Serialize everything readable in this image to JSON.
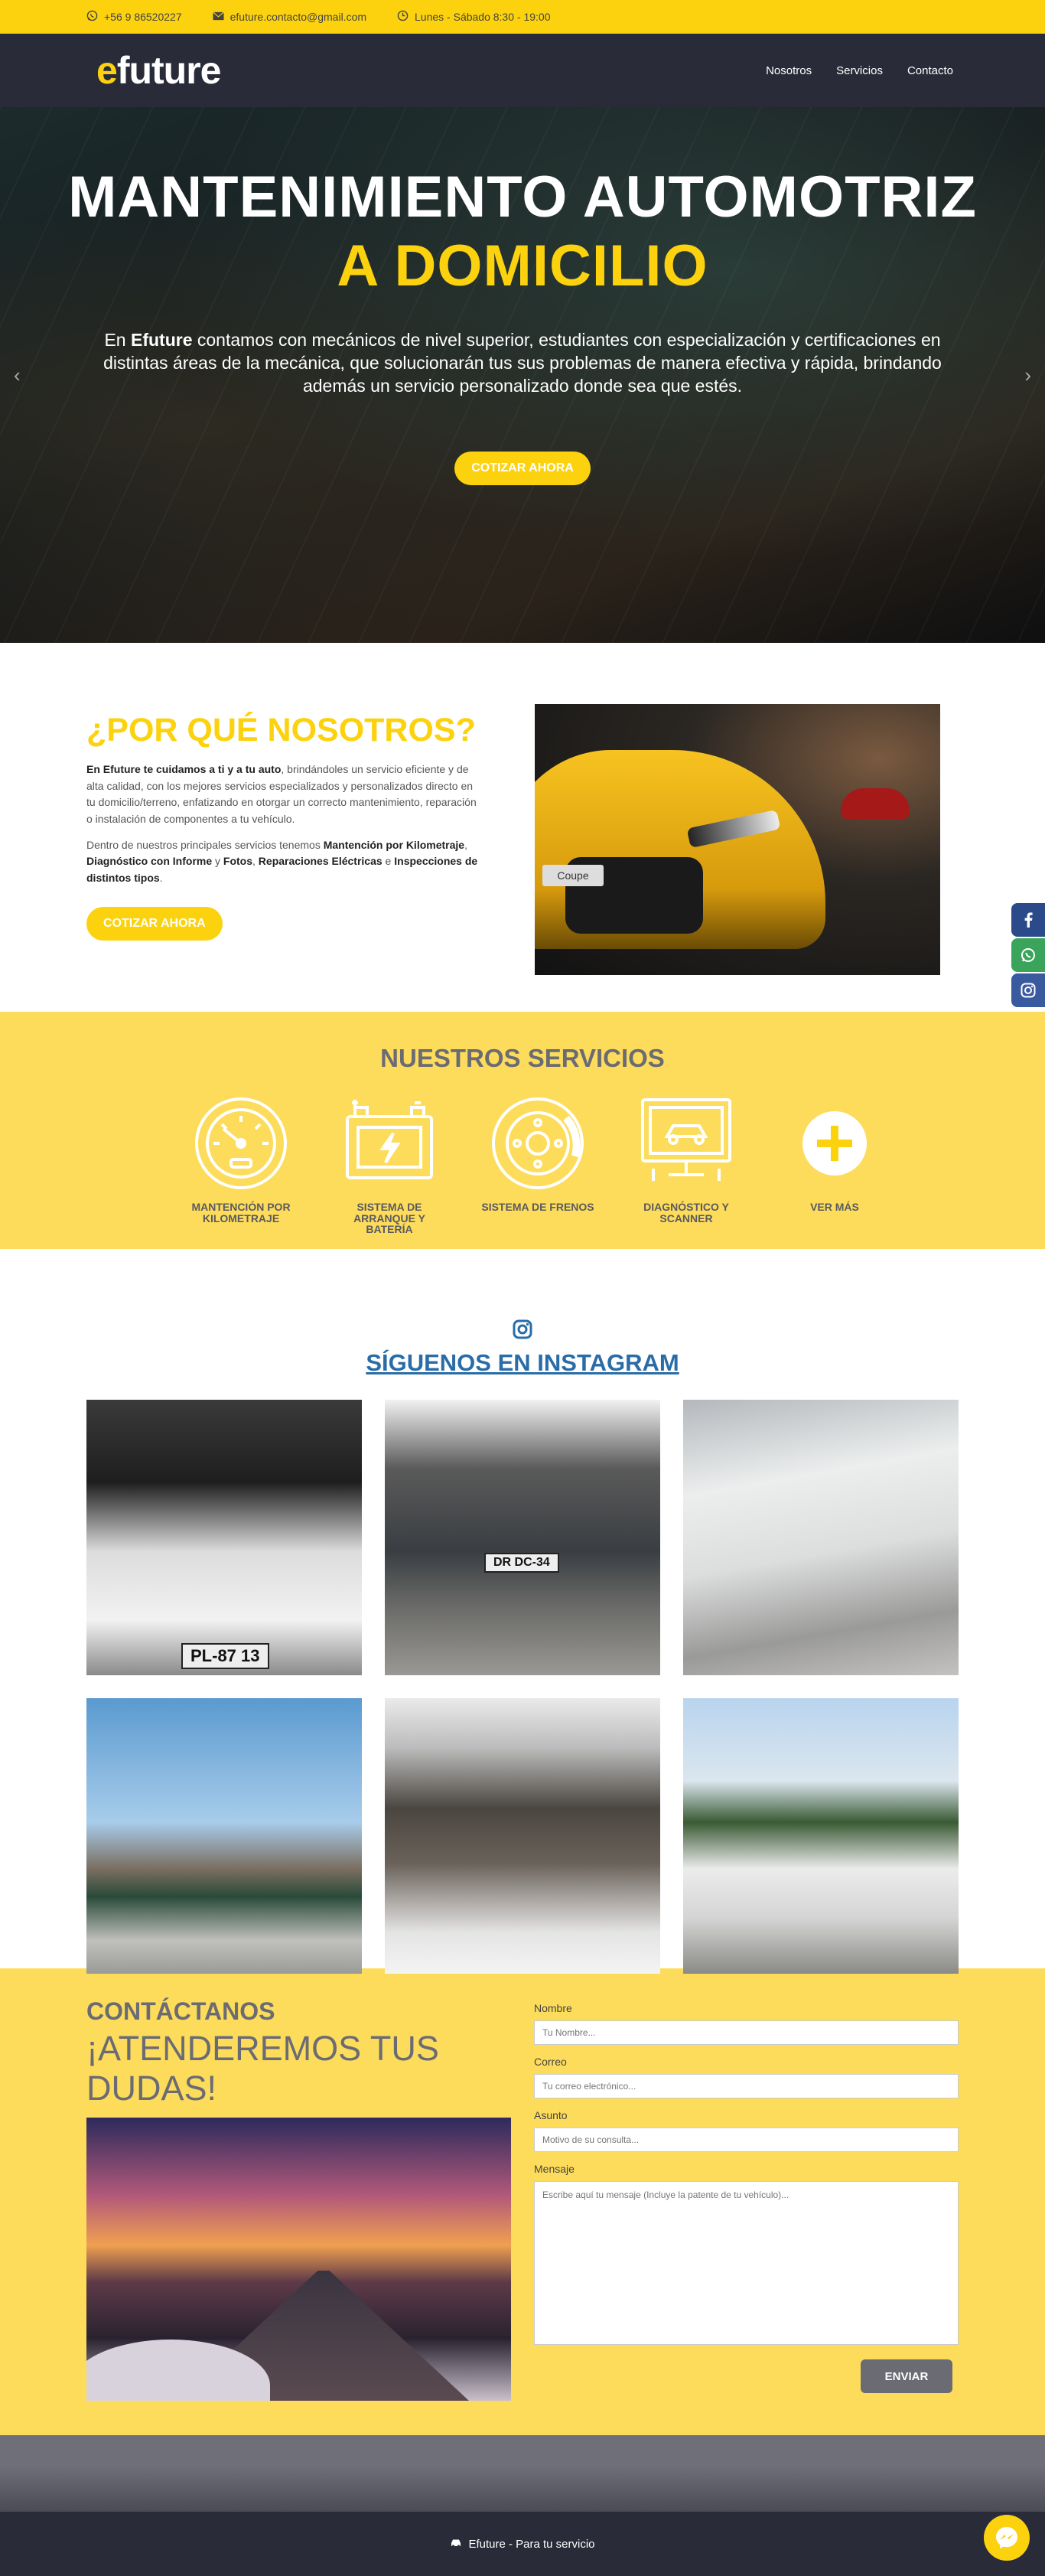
{
  "topbar": {
    "phone": "+56 9 86520227",
    "email": "efuture.contacto@gmail.com",
    "hours": "Lunes - Sábado 8:30 - 19:00"
  },
  "nav": {
    "logo_e": "e",
    "logo_rest": "future",
    "links": [
      "Nosotros",
      "Servicios",
      "Contacto"
    ]
  },
  "hero": {
    "title_line1": "MANTENIMIENTO AUTOMOTRIZ",
    "title_line2": "A DOMICILIO",
    "text_prefix": "En ",
    "text_brand": "Efuture",
    "text_body": " contamos con mecánicos de nivel superior, estudiantes con especialización y certificaciones en distintas áreas de la mecánica, que solucionarán tus sus problemas de manera efectiva y rápida, brindando además un servicio personalizado donde sea que estés.",
    "cta": "COTIZAR AHORA",
    "prev": "‹",
    "next": "›"
  },
  "why": {
    "title": "¿POR QUÉ NOSOTROS?",
    "p1_bold": "En Efuture te cuidamos a ti y a tu auto",
    "p1_rest": ", brindándoles un servicio eficiente y de alta calidad, con los mejores servicios especializados y personalizados directo en tu domicilio/terreno, enfatizando en otorgar un correcto mantenimiento, reparación o instalación de componentes a tu vehículo.",
    "p2_start": "Dentro de nuestros principales servicios tenemos ",
    "p2_b1": "Mantención por Kilometraje",
    "p2_sep1": ", ",
    "p2_b2": "Diagnóstico con Informe",
    "p2_y": " y ",
    "p2_b3": "Fotos",
    "p2_sep2": ", ",
    "p2_b4": "Reparaciones Eléctricas",
    "p2_e": " e ",
    "p2_b5": "Inspecciones de distintos tipos",
    "p2_end": ".",
    "cta": "COTIZAR AHORA",
    "image_plate": "Coupe"
  },
  "services": {
    "title": "NUESTROS SERVICIOS",
    "items": [
      {
        "label": "MANTENCIÓN POR KILOMETRAJE",
        "icon": "speedometer-icon"
      },
      {
        "label": "SISTEMA DE ARRANQUE Y BATERÍA",
        "icon": "battery-icon"
      },
      {
        "label": "SISTEMA DE FRENOS",
        "icon": "brake-disc-icon"
      },
      {
        "label": "DIAGNÓSTICO Y SCANNER",
        "icon": "scanner-monitor-icon"
      },
      {
        "label": "VER MÁS",
        "icon": "plus-icon"
      }
    ]
  },
  "instagram": {
    "title": "SÍGUENOS EN INSTAGRAM",
    "plates": [
      "PL-87 13",
      "DR DC-34"
    ]
  },
  "contact": {
    "subtitle": "CONTÁCTANOS",
    "title": "¡ATENDEREMOS TUS DUDAS!",
    "name_label": "Nombre",
    "name_placeholder": "Tu Nombre...",
    "email_label": "Correo",
    "email_placeholder": "Tu correo electrónico...",
    "subject_label": "Asunto",
    "subject_placeholder": "Motivo de su consulta...",
    "message_label": "Mensaje",
    "message_placeholder": "Escribe aquí tu mensaje (Incluye la patente de tu vehículo)...",
    "send": "ENVIAR"
  },
  "footer": {
    "text": "Efuture - Para tu servicio"
  },
  "colors": {
    "brand_yellow": "#fcd20f",
    "light_yellow": "#fddc5b",
    "dark_navy": "#2a2b39",
    "link_blue": "#2a6ca8"
  }
}
